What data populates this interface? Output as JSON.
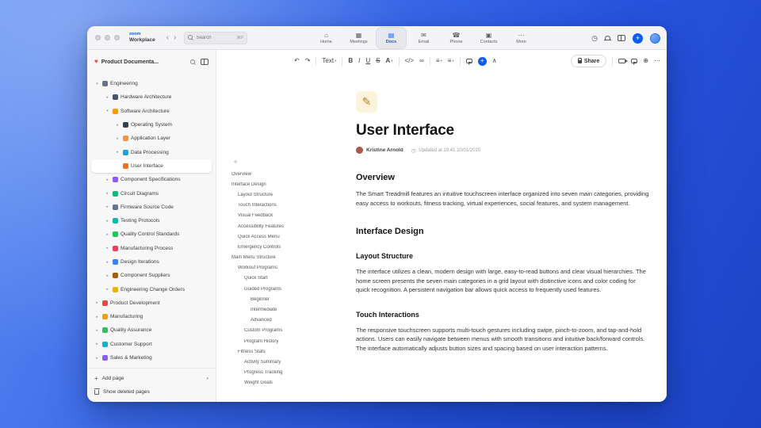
{
  "topbar": {
    "logo": {
      "zoom": "zoom",
      "workplace": "Workplace"
    },
    "nav": {
      "back": "‹",
      "forward": "›"
    },
    "search": {
      "placeholder": "Search",
      "shortcut": "⌘F"
    },
    "tabs": [
      {
        "label": "Home",
        "icon": "home-icon",
        "glyph": "⌂"
      },
      {
        "label": "Meetings",
        "icon": "calendar-icon",
        "glyph": "▦"
      },
      {
        "label": "Docs",
        "icon": "document-icon",
        "glyph": "▤",
        "active": true
      },
      {
        "label": "Email",
        "icon": "mail-icon",
        "glyph": "✉"
      },
      {
        "label": "Phone",
        "icon": "phone-icon",
        "glyph": "☎"
      },
      {
        "label": "Contacts",
        "icon": "contacts-icon",
        "glyph": "▣"
      },
      {
        "label": "More",
        "icon": "more-icon",
        "glyph": "⋯"
      }
    ],
    "right_icons": {
      "history": "◷",
      "plus": "+"
    }
  },
  "sidebar": {
    "workspace_title": "Product Documenta...",
    "items": [
      {
        "label": "Engineering",
        "level": 0,
        "chevron": "▾",
        "icon": "gear-icon",
        "color": "#64748b"
      },
      {
        "label": "Hardware Architecture",
        "level": 1,
        "chevron": "▸",
        "icon": "chip-icon",
        "color": "#475569"
      },
      {
        "label": "Software Architecture",
        "level": 1,
        "chevron": "▾",
        "icon": "laptop-icon",
        "color": "#f59e0b"
      },
      {
        "label": "Operating System",
        "level": 2,
        "chevron": "▸",
        "icon": "terminal-icon",
        "color": "#334155"
      },
      {
        "label": "Application Layer",
        "level": 2,
        "chevron": "▸",
        "icon": "package-icon",
        "color": "#fb923c"
      },
      {
        "label": "Data Processing",
        "level": 2,
        "chevron": "▸",
        "icon": "chart-icon",
        "color": "#0ea5e9"
      },
      {
        "label": "User Interface",
        "level": 2,
        "chevron": "",
        "icon": "palette-icon",
        "color": "#f97316",
        "selected": true
      },
      {
        "label": "Component Specifications",
        "level": 1,
        "chevron": "▸",
        "icon": "clipboard-icon",
        "color": "#8b5cf6"
      },
      {
        "label": "Circuit Diagrams",
        "level": 1,
        "chevron": "▸",
        "icon": "plug-icon",
        "color": "#10b981"
      },
      {
        "label": "Firmware Source Code",
        "level": 1,
        "chevron": "▸",
        "icon": "disk-icon",
        "color": "#64748b"
      },
      {
        "label": "Testing Protocols",
        "level": 1,
        "chevron": "▸",
        "icon": "flask-icon",
        "color": "#14b8a6"
      },
      {
        "label": "Quality Control Standards",
        "level": 1,
        "chevron": "▸",
        "icon": "check-icon",
        "color": "#22c55e"
      },
      {
        "label": "Manufacturing Process",
        "level": 1,
        "chevron": "▸",
        "icon": "factory-icon",
        "color": "#f43f5e"
      },
      {
        "label": "Design Iterations",
        "level": 1,
        "chevron": "▸",
        "icon": "loop-icon",
        "color": "#3b82f6"
      },
      {
        "label": "Component Suppliers",
        "level": 1,
        "chevron": "▸",
        "icon": "box-icon",
        "color": "#a16207"
      },
      {
        "label": "Engineering Change Orders",
        "level": 1,
        "chevron": "▸",
        "icon": "memo-icon",
        "color": "#eab308"
      },
      {
        "label": "Product Development",
        "level": 0,
        "chevron": "▸",
        "icon": "rocket-icon",
        "color": "#ef4444"
      },
      {
        "label": "Manufacturing",
        "level": 0,
        "chevron": "▸",
        "icon": "factory-icon",
        "color": "#f59e0b"
      },
      {
        "label": "Quality Assurance",
        "level": 0,
        "chevron": "▸",
        "icon": "badge-icon",
        "color": "#22c55e"
      },
      {
        "label": "Customer Support",
        "level": 0,
        "chevron": "▸",
        "icon": "chat-icon",
        "color": "#06b6d4"
      },
      {
        "label": "Sales & Marketing",
        "level": 0,
        "chevron": "▸",
        "icon": "trend-icon",
        "color": "#8b5cf6"
      }
    ],
    "add_page_label": "Add page",
    "add_page_plus": "+",
    "add_page_chevron": "▾",
    "show_deleted_label": "Show deleted pages"
  },
  "toolbar": {
    "icons": {
      "undo": "↶",
      "redo": "↷",
      "dropdown": "▾",
      "bold": "B",
      "italic": "I",
      "underline": "U",
      "strikethrough": "S",
      "code": "</>",
      "link": "∞",
      "list": "≡",
      "align": "≡",
      "insert_plus": "+",
      "collapse": "∧",
      "globe": "⊕",
      "more": "⋯"
    },
    "text_style_label": "Text",
    "text_color_label": "A",
    "share_label": "Share",
    "collaborators": [
      {
        "color": "#e8a0b4"
      },
      {
        "color": "#8fcf9f"
      },
      {
        "color": "#b3a3e8"
      }
    ]
  },
  "outline": {
    "collapse_glyph": "«",
    "items": [
      {
        "label": "Overview",
        "level": 0
      },
      {
        "label": "Interface Design",
        "level": 0
      },
      {
        "label": "Layout Structure",
        "level": 1
      },
      {
        "label": "Touch Interactions",
        "level": 1
      },
      {
        "label": "Visual Feedback",
        "level": 1
      },
      {
        "label": "Accessibility Features",
        "level": 1
      },
      {
        "label": "Quick Access Menu",
        "level": 1
      },
      {
        "label": "Emergency Controls",
        "level": 1
      },
      {
        "label": "Main Menu Structure",
        "level": 0
      },
      {
        "label": "Workout Programs",
        "level": 1
      },
      {
        "label": "Quick Start",
        "level": 2
      },
      {
        "label": "Guided Programs",
        "level": 2
      },
      {
        "label": "Beginner",
        "level": 3
      },
      {
        "label": "Intermediate",
        "level": 3
      },
      {
        "label": "Advanced",
        "level": 3
      },
      {
        "label": "Custom Programs",
        "level": 2
      },
      {
        "label": "Program History",
        "level": 2
      },
      {
        "label": "Fitness Stats",
        "level": 1
      },
      {
        "label": "Activity Summary",
        "level": 2
      },
      {
        "label": "Progress Tracking",
        "level": 2
      },
      {
        "label": "Weight Goals",
        "level": 2
      }
    ]
  },
  "doc": {
    "icon_glyph": "✎",
    "title": "User Interface",
    "author": "Kristine Arnold",
    "updated_clock": "◷",
    "updated": "Updated at 19:41 10/01/2020",
    "blocks": [
      {
        "type": "h2",
        "text": "Overview"
      },
      {
        "type": "p",
        "text": "The Smart Treadmill features an intuitive touchscreen interface organized into seven main categories, providing easy access to workouts, fitness tracking, virtual experiences, social features, and system management."
      },
      {
        "type": "h2",
        "text": "Interface Design"
      },
      {
        "type": "h3",
        "text": "Layout Structure"
      },
      {
        "type": "p",
        "text": "The interface utilizes a clean, modern design with large, easy-to-read buttons and clear visual hierarchies. The home screen presents the seven main categories in a grid layout with distinctive icons and color coding for quick recognition. A persistent navigation bar allows quick access to frequently used features."
      },
      {
        "type": "h3",
        "text": "Touch Interactions"
      },
      {
        "type": "p",
        "text": "The responsive touchscreen supports multi-touch gestures including swipe, pinch-to-zoom, and tap-and-hold actions. Users can easily navigate between menus with smooth transitions and intuitive back/forward controls. The interface automatically adjusts button sizes and spacing based on user interaction patterns."
      }
    ]
  }
}
